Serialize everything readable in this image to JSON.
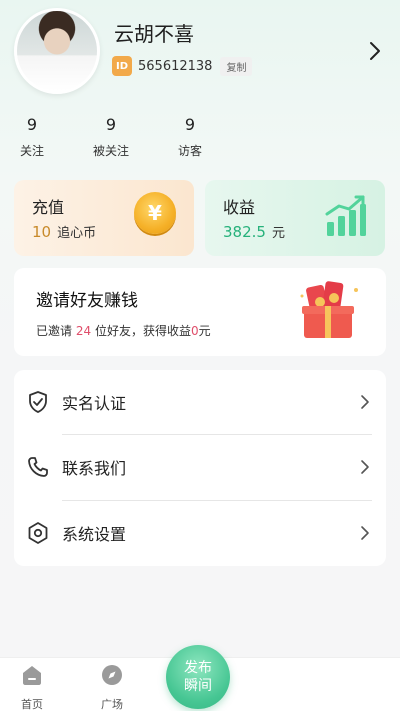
{
  "profile": {
    "nickname": "云胡不喜",
    "id_badge": "ID",
    "id_number": "565612138",
    "copy_label": "复制"
  },
  "stats": [
    {
      "value": "9",
      "label": "关注"
    },
    {
      "value": "9",
      "label": "被关注"
    },
    {
      "value": "9",
      "label": "访客"
    }
  ],
  "recharge": {
    "title": "充值",
    "value": "10",
    "unit": "追心币",
    "coin_symbol": "¥"
  },
  "income": {
    "title": "收益",
    "value": "382.5",
    "unit": "元"
  },
  "invite": {
    "title": "邀请好友赚钱",
    "desc_prefix": "已邀请",
    "invited_count": "24",
    "desc_middle": "位好友，获得收益",
    "earned": "0",
    "desc_suffix": "元"
  },
  "menu": [
    {
      "label": "实名认证",
      "icon": "shield-check-icon"
    },
    {
      "label": "联系我们",
      "icon": "phone-icon"
    },
    {
      "label": "系统设置",
      "icon": "settings-hex-icon"
    }
  ],
  "tabbar": {
    "home_label": "首页",
    "plaza_label": "广场",
    "publish_line1": "发布",
    "publish_line2": "瞬间"
  },
  "colors": {
    "accent_green": "#46c693",
    "orange": "#f2a94a",
    "highlight_red": "#e04f6b"
  }
}
